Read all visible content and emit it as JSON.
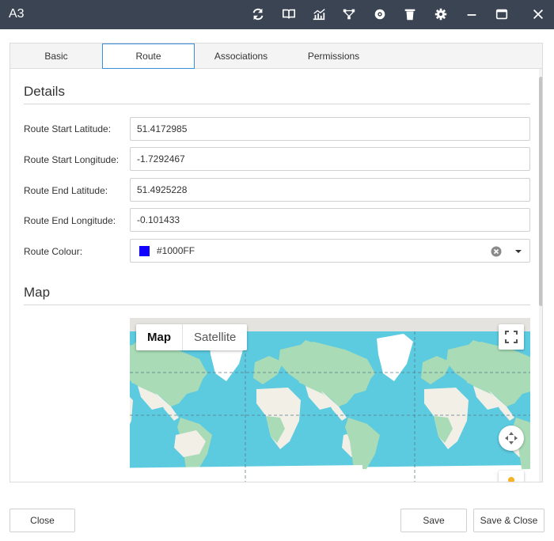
{
  "window": {
    "title": "A3",
    "toolbar_icons": [
      "refresh-icon",
      "book-icon",
      "chart-icon",
      "network-icon",
      "cog-badge-icon",
      "trash-icon",
      "settings-icon",
      "minimize-icon",
      "maximize-icon",
      "close-icon"
    ]
  },
  "tabs": [
    {
      "label": "Basic",
      "active": false
    },
    {
      "label": "Route",
      "active": true
    },
    {
      "label": "Associations",
      "active": false
    },
    {
      "label": "Permissions",
      "active": false
    }
  ],
  "details": {
    "title": "Details",
    "fields": [
      {
        "label": "Route Start Latitude:",
        "value": "51.4172985"
      },
      {
        "label": "Route Start Longitude:",
        "value": "-1.7292467"
      },
      {
        "label": "Route End Latitude:",
        "value": "51.4925228"
      },
      {
        "label": "Route End Longitude:",
        "value": "-0.101433"
      }
    ],
    "colour": {
      "label": "Route Colour:",
      "value": "#1000FF",
      "swatch": "#1000FF"
    }
  },
  "map": {
    "title": "Map",
    "map_type_options": [
      "Map",
      "Satellite"
    ],
    "selected_type": "Map",
    "colors": {
      "water": "#5ccadf",
      "land": "#f1efe6",
      "forest": "#a8dbb6",
      "ice": "#ffffff"
    }
  },
  "footer": {
    "close_label": "Close",
    "save_label": "Save",
    "save_close_label": "Save & Close"
  }
}
